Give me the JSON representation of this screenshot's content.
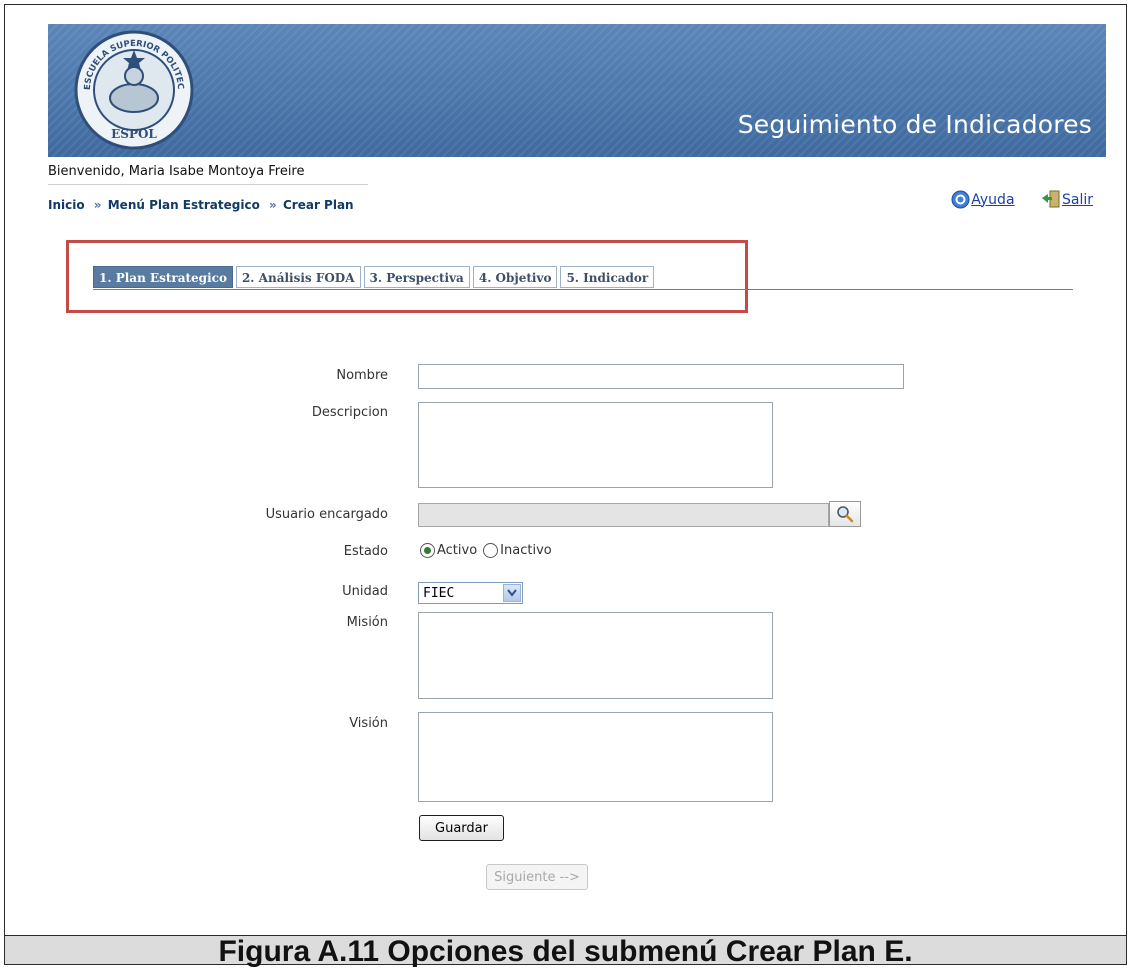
{
  "header": {
    "title": "Seguimiento de Indicadores",
    "seal_text": [
      "ESCUELA SUPERIOR POLITECNICA DEL LITORAL",
      "ESPOL"
    ]
  },
  "welcome": "Bienvenido, Maria Isabe Montoya Freire",
  "breadcrumb": {
    "separator": "»",
    "items": [
      "Inicio",
      "Menú Plan Estrategico",
      "Crear Plan"
    ]
  },
  "header_links": {
    "help": "Ayuda",
    "exit": "Salir"
  },
  "tabs": [
    {
      "label": "1. Plan Estrategico",
      "active": true
    },
    {
      "label": "2. Análisis FODA",
      "active": false
    },
    {
      "label": "3. Perspectiva",
      "active": false
    },
    {
      "label": "4. Objetivo",
      "active": false
    },
    {
      "label": "5. Indicador",
      "active": false
    }
  ],
  "form": {
    "nombre": {
      "label": "Nombre",
      "value": ""
    },
    "descripcion": {
      "label": "Descripcion",
      "value": ""
    },
    "usuario": {
      "label": "Usuario encargado",
      "value": ""
    },
    "estado": {
      "label": "Estado",
      "options": [
        "Activo",
        "Inactivo"
      ],
      "selected": "Activo"
    },
    "unidad": {
      "label": "Unidad",
      "selected": "FIEC"
    },
    "mision": {
      "label": "Misión",
      "value": ""
    },
    "vision": {
      "label": "Visión",
      "value": ""
    },
    "save_label": "Guardar",
    "next_label": "Siguiente -->"
  },
  "caption": "Figura A.11 Opciones del submenú Crear Plan E.",
  "colors": {
    "banner": "#3f6aa0",
    "active_tab": "#5a7ba0",
    "highlight": "#c24b47",
    "breadcrumb": "#123a66"
  },
  "icons": [
    "espol-seal",
    "help-icon",
    "exit-icon",
    "search-icon",
    "dropdown-arrow-icon"
  ]
}
